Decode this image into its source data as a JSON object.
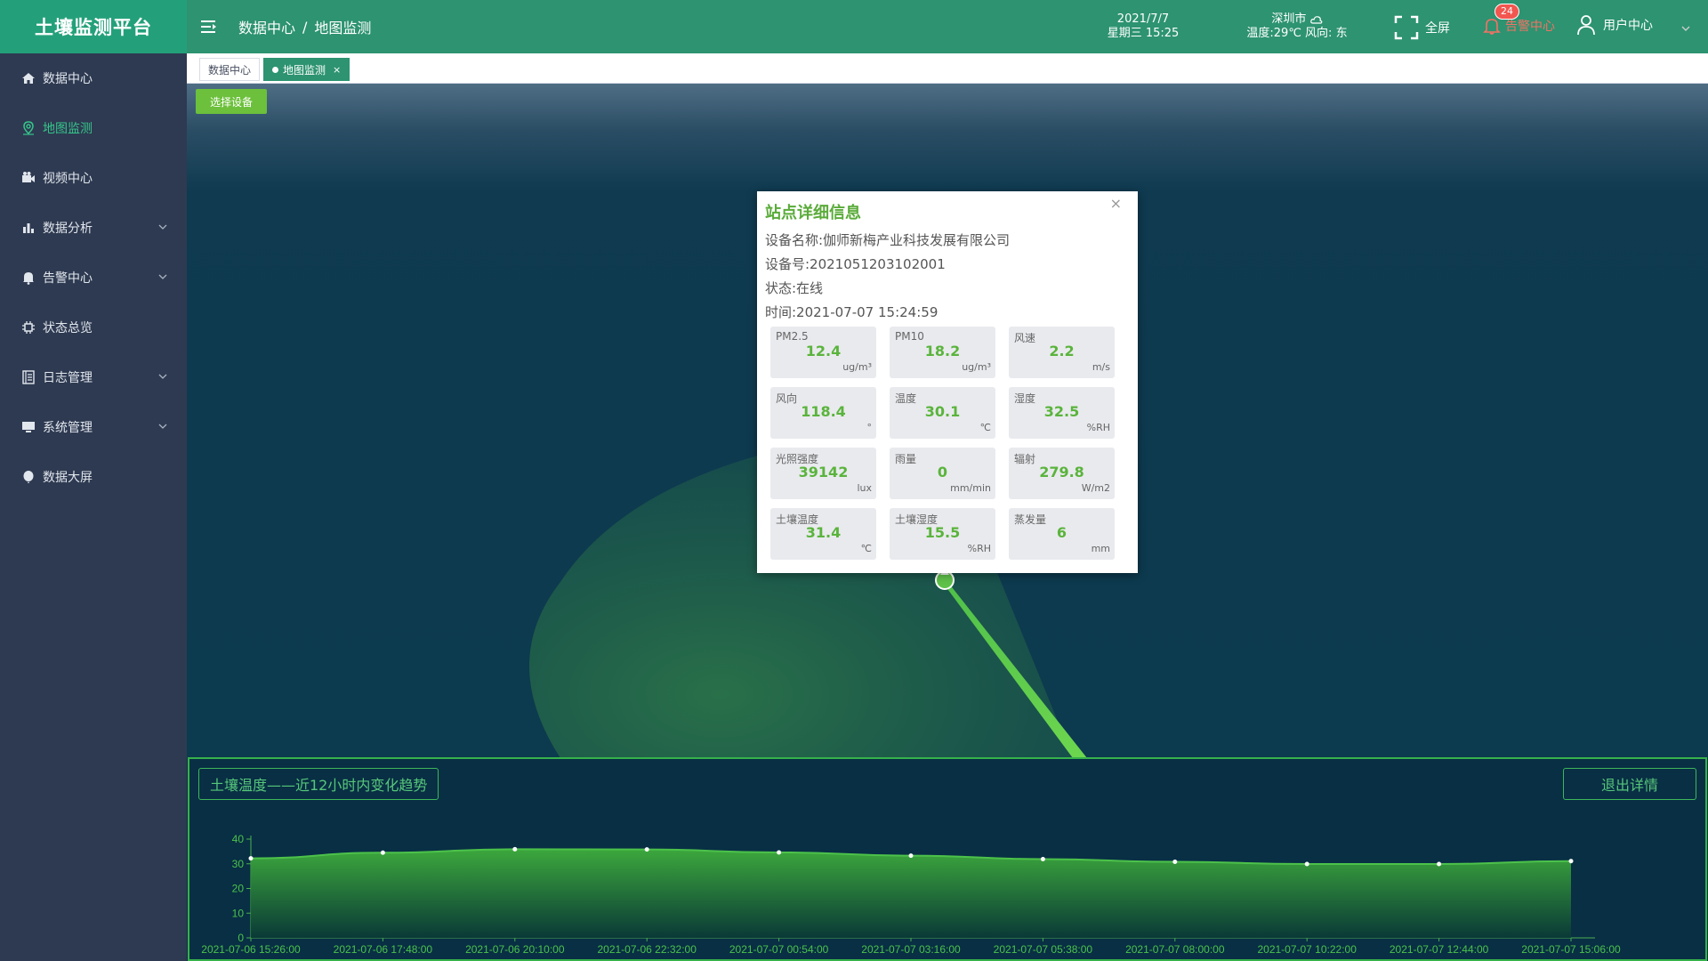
{
  "brand": {
    "title": "土壤监测平台"
  },
  "breadcrumb": {
    "items": [
      "数据中心",
      "地图监测"
    ],
    "sep": "/"
  },
  "header": {
    "date": "2021/7/7",
    "weekday_time": "星期三 15:25",
    "city": "深圳市",
    "weather_line": "温度:29℃ 风向: 东",
    "fullscreen_label": "全屏",
    "alarm_label": "告警中心",
    "alarm_count": "24",
    "user_label": "用户中心"
  },
  "sidebar": {
    "items": [
      {
        "label": "数据中心",
        "icon": "home-icon"
      },
      {
        "label": "地图监测",
        "icon": "map-pin-icon"
      },
      {
        "label": "视频中心",
        "icon": "video-icon"
      },
      {
        "label": "数据分析",
        "icon": "bar-chart-icon"
      },
      {
        "label": "告警中心",
        "icon": "bell-icon"
      },
      {
        "label": "状态总览",
        "icon": "chip-icon"
      },
      {
        "label": "日志管理",
        "icon": "log-icon"
      },
      {
        "label": "系统管理",
        "icon": "monitor-icon"
      },
      {
        "label": "数据大屏",
        "icon": "balloon-icon"
      }
    ]
  },
  "tabs": [
    {
      "label": "数据中心"
    },
    {
      "label": "地图监测",
      "close": "×"
    }
  ],
  "map": {
    "select_button": "选择设备"
  },
  "popup": {
    "title": "站点详细信息",
    "close": "×",
    "device_name": "设备名称:伽师新梅产业科技发展有限公司",
    "device_no": "设备号:2021051203102001",
    "status": "状态:在线",
    "time": "时间:2021-07-07 15:24:59",
    "metrics": [
      {
        "label": "PM2.5",
        "value": "12.4",
        "unit": "ug/m³"
      },
      {
        "label": "PM10",
        "value": "18.2",
        "unit": "ug/m³"
      },
      {
        "label": "风速",
        "value": "2.2",
        "unit": "m/s"
      },
      {
        "label": "风向",
        "value": "118.4",
        "unit": "°"
      },
      {
        "label": "温度",
        "value": "30.1",
        "unit": "℃"
      },
      {
        "label": "湿度",
        "value": "32.5",
        "unit": "%RH"
      },
      {
        "label": "光照强度",
        "value": "39142",
        "unit": "lux"
      },
      {
        "label": "雨量",
        "value": "0",
        "unit": "mm/min"
      },
      {
        "label": "辐射",
        "value": "279.8",
        "unit": "W/m2"
      },
      {
        "label": "土壤温度",
        "value": "31.4",
        "unit": "℃"
      },
      {
        "label": "土壤湿度",
        "value": "15.5",
        "unit": "%RH"
      },
      {
        "label": "蒸发量",
        "value": "6",
        "unit": "mm"
      }
    ]
  },
  "chart_panel": {
    "title": "土壤温度——近12小时内变化趋势",
    "exit_button": "退出详情"
  },
  "chart_data": {
    "type": "area",
    "x": [
      "2021-07-06 15:26:00",
      "2021-07-06 17:48:00",
      "2021-07-06 20:10:00",
      "2021-07-06 22:32:00",
      "2021-07-07 00:54:00",
      "2021-07-07 03:16:00",
      "2021-07-07 05:38:00",
      "2021-07-07 08:00:00",
      "2021-07-07 10:22:00",
      "2021-07-07 12:44:00",
      "2021-07-07 15:06:00"
    ],
    "series": [
      {
        "values": [
          32.2,
          34.5,
          35.9,
          35.8,
          34.6,
          33.3,
          31.9,
          30.8,
          29.9,
          29.9,
          31.1
        ]
      }
    ],
    "yticks": [
      0,
      10,
      20,
      30,
      40
    ],
    "ylim": [
      0,
      40
    ],
    "colors": {
      "line": "#4cc24a",
      "fill_top": "#3fae3c",
      "fill_bottom": "#0a3a36",
      "axis": "#4caf50",
      "label": "#4cc24a"
    }
  }
}
